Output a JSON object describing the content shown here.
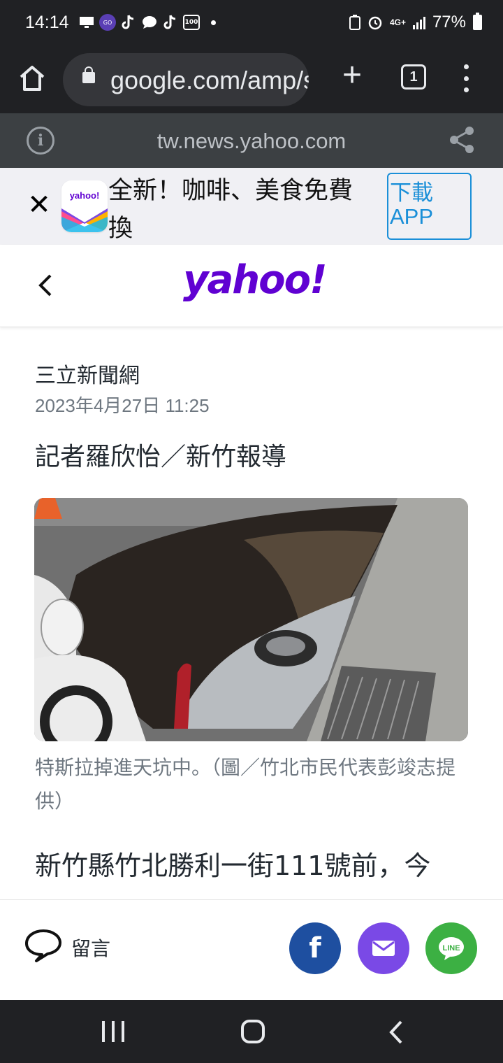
{
  "status_bar": {
    "time": "14:14",
    "network": "4G+",
    "battery": "77%"
  },
  "browser": {
    "url": "google.com/amp/s/tw.news.yahoo.com",
    "tab_count": "1"
  },
  "amp_bar": {
    "domain": "tw.news.yahoo.com"
  },
  "promo": {
    "logo_text": "yahoo!",
    "text": "全新！咖啡、美食免費換",
    "download_label": "下載APP"
  },
  "header": {
    "logo": "yahoo!"
  },
  "article": {
    "source": "三立新聞網",
    "date": "2023年4月27日 11:25",
    "byline": "記者羅欣怡／新竹報導",
    "image_caption": "特斯拉掉進天坑中。（圖／竹北市民代表彭竣志提供）",
    "body_first_line": "新竹縣竹北勝利一街111號前，今"
  },
  "share_bar": {
    "comment_label": "留言",
    "facebook_glyph": "f"
  },
  "colors": {
    "yahoo_purple": "#6001d2",
    "facebook": "#1e4fa0",
    "mail": "#7a49e6",
    "line": "#3cb043",
    "download_blue": "#1a8fd8"
  }
}
